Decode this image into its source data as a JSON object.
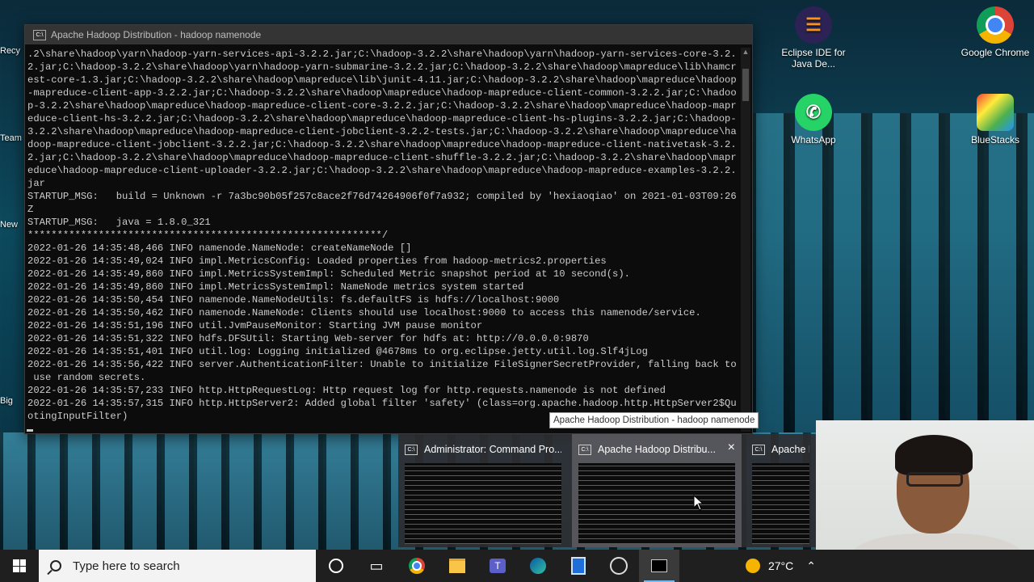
{
  "desktop": {
    "icons_right": [
      {
        "label": "Eclipse IDE for Java De...",
        "glyph": "eclipse-icon",
        "color": "#2c2255"
      },
      {
        "label": "Google Chrome",
        "glyph": "chrome-icon",
        "color": "#db4437"
      },
      {
        "label": "WhatsApp",
        "glyph": "whatsapp-icon",
        "color": "#25d366"
      },
      {
        "label": "BlueStacks",
        "glyph": "bluestacks-icon",
        "color": "#4caf50"
      }
    ],
    "left_peek_labels": [
      "Recy",
      "Team",
      "New",
      "Big"
    ]
  },
  "cmd_window": {
    "title": "Apache Hadoop Distribution - hadoop   namenode",
    "lines": [
      ".2\\share\\hadoop\\yarn\\hadoop-yarn-services-api-3.2.2.jar;C:\\hadoop-3.2.2\\share\\hadoop\\yarn\\hadoop-yarn-services-core-3.2.",
      "2.jar;C:\\hadoop-3.2.2\\share\\hadoop\\yarn\\hadoop-yarn-submarine-3.2.2.jar;C:\\hadoop-3.2.2\\share\\hadoop\\mapreduce\\lib\\hamcr",
      "est-core-1.3.jar;C:\\hadoop-3.2.2\\share\\hadoop\\mapreduce\\lib\\junit-4.11.jar;C:\\hadoop-3.2.2\\share\\hadoop\\mapreduce\\hadoop",
      "-mapreduce-client-app-3.2.2.jar;C:\\hadoop-3.2.2\\share\\hadoop\\mapreduce\\hadoop-mapreduce-client-common-3.2.2.jar;C:\\hadoo",
      "p-3.2.2\\share\\hadoop\\mapreduce\\hadoop-mapreduce-client-core-3.2.2.jar;C:\\hadoop-3.2.2\\share\\hadoop\\mapreduce\\hadoop-mapr",
      "educe-client-hs-3.2.2.jar;C:\\hadoop-3.2.2\\share\\hadoop\\mapreduce\\hadoop-mapreduce-client-hs-plugins-3.2.2.jar;C:\\hadoop-",
      "3.2.2\\share\\hadoop\\mapreduce\\hadoop-mapreduce-client-jobclient-3.2.2-tests.jar;C:\\hadoop-3.2.2\\share\\hadoop\\mapreduce\\ha",
      "doop-mapreduce-client-jobclient-3.2.2.jar;C:\\hadoop-3.2.2\\share\\hadoop\\mapreduce\\hadoop-mapreduce-client-nativetask-3.2.",
      "2.jar;C:\\hadoop-3.2.2\\share\\hadoop\\mapreduce\\hadoop-mapreduce-client-shuffle-3.2.2.jar;C:\\hadoop-3.2.2\\share\\hadoop\\mapr",
      "educe\\hadoop-mapreduce-client-uploader-3.2.2.jar;C:\\hadoop-3.2.2\\share\\hadoop\\mapreduce\\hadoop-mapreduce-examples-3.2.2.",
      "jar",
      "STARTUP_MSG:   build = Unknown -r 7a3bc90b05f257c8ace2f76d74264906f0f7a932; compiled by 'hexiaoqiao' on 2021-01-03T09:26",
      "Z",
      "STARTUP_MSG:   java = 1.8.0_321",
      "************************************************************/",
      "2022-01-26 14:35:48,466 INFO namenode.NameNode: createNameNode []",
      "2022-01-26 14:35:49,024 INFO impl.MetricsConfig: Loaded properties from hadoop-metrics2.properties",
      "2022-01-26 14:35:49,860 INFO impl.MetricsSystemImpl: Scheduled Metric snapshot period at 10 second(s).",
      "2022-01-26 14:35:49,860 INFO impl.MetricsSystemImpl: NameNode metrics system started",
      "2022-01-26 14:35:50,454 INFO namenode.NameNodeUtils: fs.defaultFS is hdfs://localhost:9000",
      "2022-01-26 14:35:50,462 INFO namenode.NameNode: Clients should use localhost:9000 to access this namenode/service.",
      "2022-01-26 14:35:51,196 INFO util.JvmPauseMonitor: Starting JVM pause monitor",
      "2022-01-26 14:35:51,322 INFO hdfs.DFSUtil: Starting Web-server for hdfs at: http://0.0.0.0:9870",
      "2022-01-26 14:35:51,401 INFO util.log: Logging initialized @4678ms to org.eclipse.jetty.util.log.Slf4jLog",
      "2022-01-26 14:35:56,422 INFO server.AuthenticationFilter: Unable to initialize FileSignerSecretProvider, falling back to",
      " use random secrets.",
      "2022-01-26 14:35:57,233 INFO http.HttpRequestLog: Http request log for http.requests.namenode is not defined",
      "2022-01-26 14:35:57,315 INFO http.HttpServer2: Added global filter 'safety' (class=org.apache.hadoop.http.HttpServer2$Qu",
      "otingInputFilter)"
    ]
  },
  "tooltip": "Apache Hadoop Distribution - hadoop   namenode",
  "taskbar_previews": [
    {
      "title": "Administrator: Command Pro...",
      "active": false
    },
    {
      "title": "Apache Hadoop Distribu...",
      "active": true,
      "close": "×"
    },
    {
      "title": "Apache Ha",
      "active": false
    }
  ],
  "taskbar": {
    "search_placeholder": "Type here to search",
    "apps": [
      "cortana-icon",
      "task-view-icon",
      "chrome-icon",
      "file-explorer-icon",
      "teams-icon",
      "edge-icon",
      "document-icon",
      "vmware-icon",
      "cmd-icon"
    ],
    "weather": "27°C",
    "accent": "#76b9ed"
  }
}
